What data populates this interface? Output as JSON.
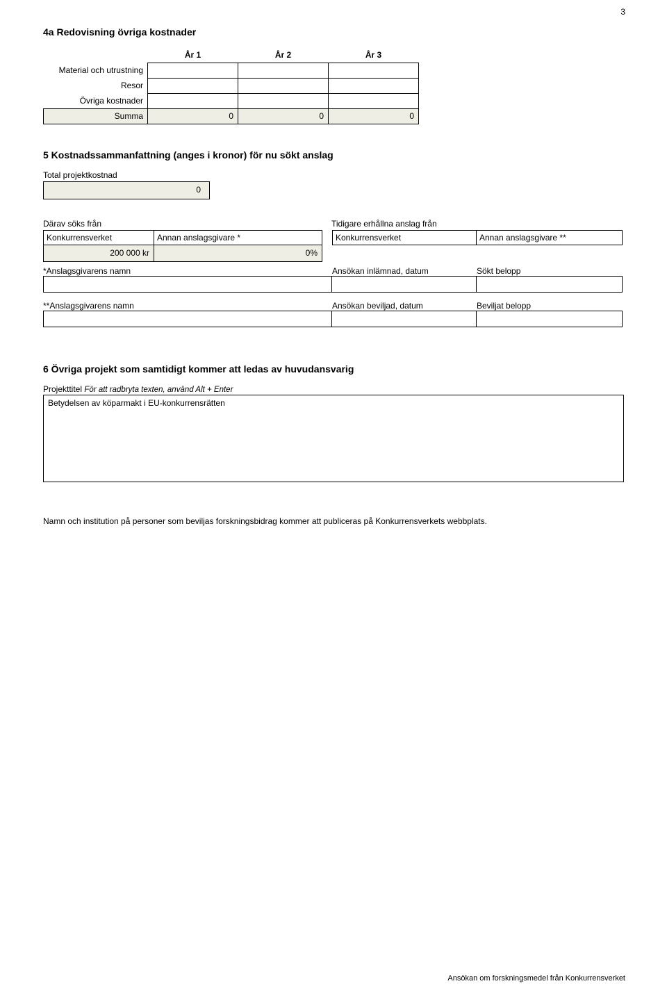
{
  "page_number": "3",
  "section4a": {
    "title": "4a  Redovisning övriga kostnader",
    "headers": {
      "y1": "År 1",
      "y2": "År 2",
      "y3": "År 3"
    },
    "rows": {
      "material": "Material och utrustning",
      "resor": "Resor",
      "ovriga": "Övriga kostnader",
      "summa": "Summa"
    },
    "summa_vals": {
      "v1": "0",
      "v2": "0",
      "v3": "0"
    }
  },
  "section5": {
    "title": "5  Kostnadssammanfattning (anges i kronor) för nu sökt anslag",
    "total_label": "Total projektkostnad",
    "total_value": "0",
    "darav": "Därav söks från",
    "tidigare": "Tidigare erhållna anslag från",
    "kv1": "Konkurrensverket",
    "annan1": "Annan anslagsgivare *",
    "kv2": "Konkurrensverket",
    "annan2": "Annan anslagsgivare **",
    "amount": "200 000 kr",
    "percent": "0%",
    "anslagsgivare1_label": "*Anslagsgivarens namn",
    "inlamnad_label": "Ansökan inlämnad, datum",
    "sokt_label": "Sökt belopp",
    "anslagsgivare2_label": "**Anslagsgivarens namn",
    "beviljad_label": "Ansökan beviljad, datum",
    "beviljat_label": "Beviljat belopp"
  },
  "section6": {
    "title": "6  Övriga projekt som samtidigt kommer att ledas av huvudansvarig",
    "sub_label": "Projekttitel",
    "sub_hint": "För att radbryta texten, använd Alt + Enter",
    "content": "Betydelsen av köparmakt i EU-konkurrensrätten"
  },
  "disclaimer": "Namn och institution på personer som beviljas forskningsbidrag kommer att publiceras på Konkurrensverkets webbplats.",
  "footer": "Ansökan om forskningsmedel från Konkurrensverket"
}
